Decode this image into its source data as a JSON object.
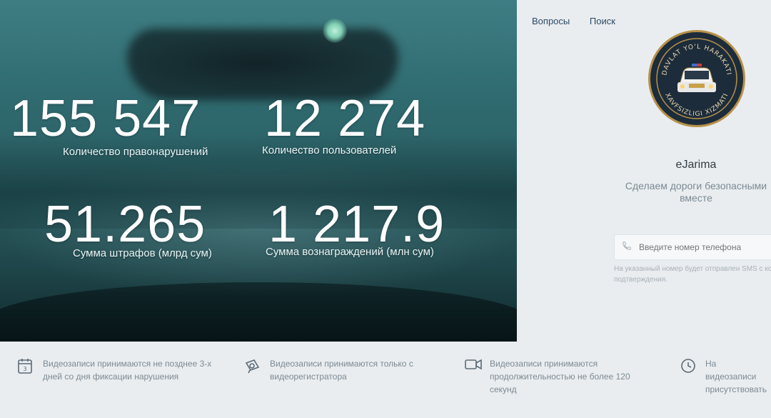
{
  "nav": {
    "items": [
      "Вопросы",
      "Поиск"
    ]
  },
  "stats": [
    {
      "value": "155 547",
      "label": "Количество правонарушений"
    },
    {
      "value": "12 274",
      "label": "Количество пользователей"
    },
    {
      "value": "51.265",
      "label": "Сумма штрафов (млрд сум)"
    },
    {
      "value": "1 217.9",
      "label": "Сумма вознаграждений (млн сум)"
    }
  ],
  "sidebar": {
    "logo_text": "DAVLAT YO'L HARAKATI XAVFSIZLIGI XIZMATI",
    "brand": "eJarima",
    "tagline": "Сделаем дороги безопасными вместе",
    "phone_placeholder": "Введите номер телефона",
    "phone_note": "На указанный номер будет отправлен SMS с кодом подтверждения."
  },
  "info": [
    {
      "icon": "calendar-icon",
      "text": "Видеозаписи принимаются не позднее 3-х дней со дня фиксации нарушения"
    },
    {
      "icon": "dashcam-icon",
      "text": "Видеозаписи принимаются только с видеорегистратора"
    },
    {
      "icon": "video-camera-icon",
      "text": "Видеозаписи принимаются продолжительностью не более 120 секунд"
    },
    {
      "icon": "clock-icon",
      "text": "На видеозаписи присутствовать"
    }
  ],
  "colors": {
    "accent": "#2b4a66",
    "hero": "#2f6b70",
    "logo_ring": "#b69149"
  }
}
